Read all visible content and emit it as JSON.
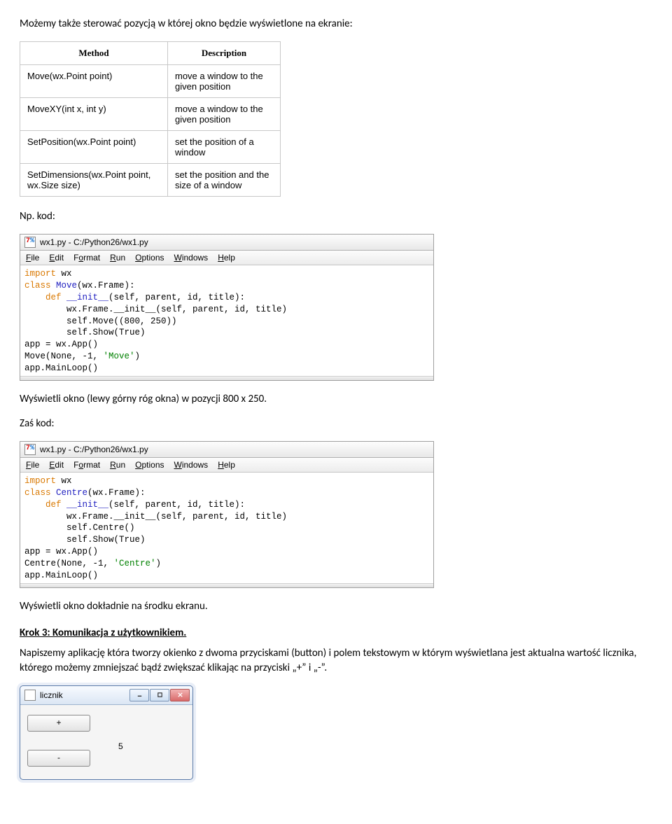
{
  "para1": "Możemy także sterować pozycją w której okno będzie wyświetlone na ekranie:",
  "methods_table": {
    "headers": {
      "method": "Method",
      "description": "Description"
    },
    "rows": [
      {
        "method": "Move(wx.Point point)",
        "description": "move a window to the given position"
      },
      {
        "method": "MoveXY(int x, int y)",
        "description": "move a window to the given position"
      },
      {
        "method": "SetPosition(wx.Point point)",
        "description": "set the position of a window"
      },
      {
        "method": "SetDimensions(wx.Point point, wx.Size size)",
        "description": "set the position and the size of a window"
      }
    ]
  },
  "para2": "Np. kod:",
  "idle1": {
    "title": "wx1.py - C:/Python26/wx1.py",
    "menu": {
      "file": "File",
      "edit": "Edit",
      "format": "Format",
      "run": "Run",
      "options": "Options",
      "windows": "Windows",
      "help": "Help"
    },
    "code": {
      "l1a": "import",
      "l1b": " wx",
      "l2a": "class",
      "l2b": " Move",
      "l2c": "(wx.Frame):",
      "l3a": "    def",
      "l3b": " __init__",
      "l3c": "(self, parent, id, title):",
      "l4": "        wx.Frame.__init__(self, parent, id, title)",
      "l5": "        self.Move((800, 250))",
      "l6": "        self.Show(True)",
      "l7": "app = wx.App()",
      "l8a": "Move(None, -1, ",
      "l8b": "'Move'",
      "l8c": ")",
      "l9": "app.MainLoop()"
    }
  },
  "para3": "Wyświetli okno (lewy górny róg okna) w pozycji 800 x 250.",
  "para4": "Zaś kod:",
  "idle2": {
    "title": "wx1.py - C:/Python26/wx1.py",
    "menu": {
      "file": "File",
      "edit": "Edit",
      "format": "Format",
      "run": "Run",
      "options": "Options",
      "windows": "Windows",
      "help": "Help"
    },
    "code": {
      "l1a": "import",
      "l1b": " wx",
      "l2a": "class",
      "l2b": " Centre",
      "l2c": "(wx.Frame):",
      "l3a": "    def",
      "l3b": " __init__",
      "l3c": "(self, parent, id, title):",
      "l4": "        wx.Frame.__init__(self, parent, id, title)",
      "l5": "        self.Centre()",
      "l6": "        self.Show(True)",
      "l7": "app = wx.App()",
      "l8a": "Centre(None, -1, ",
      "l8b": "'Centre'",
      "l8c": ")",
      "l9": "app.MainLoop()"
    }
  },
  "para5": "Wyświetli okno dokładnie na środku ekranu.",
  "heading_step3": "Krok 3: Komunikacja z użytkownikiem.",
  "para6": "Napiszemy aplikację która tworzy okienko z dwoma przyciskami (button) i polem tekstowym w którym wyświetlana jest aktualna wartość licznika, którego możemy zmniejszać bądź zwiększać klikając na przyciski „+” i „-”.",
  "licznik": {
    "title": "licznik",
    "plus": "+",
    "minus": "-",
    "value": "5"
  }
}
